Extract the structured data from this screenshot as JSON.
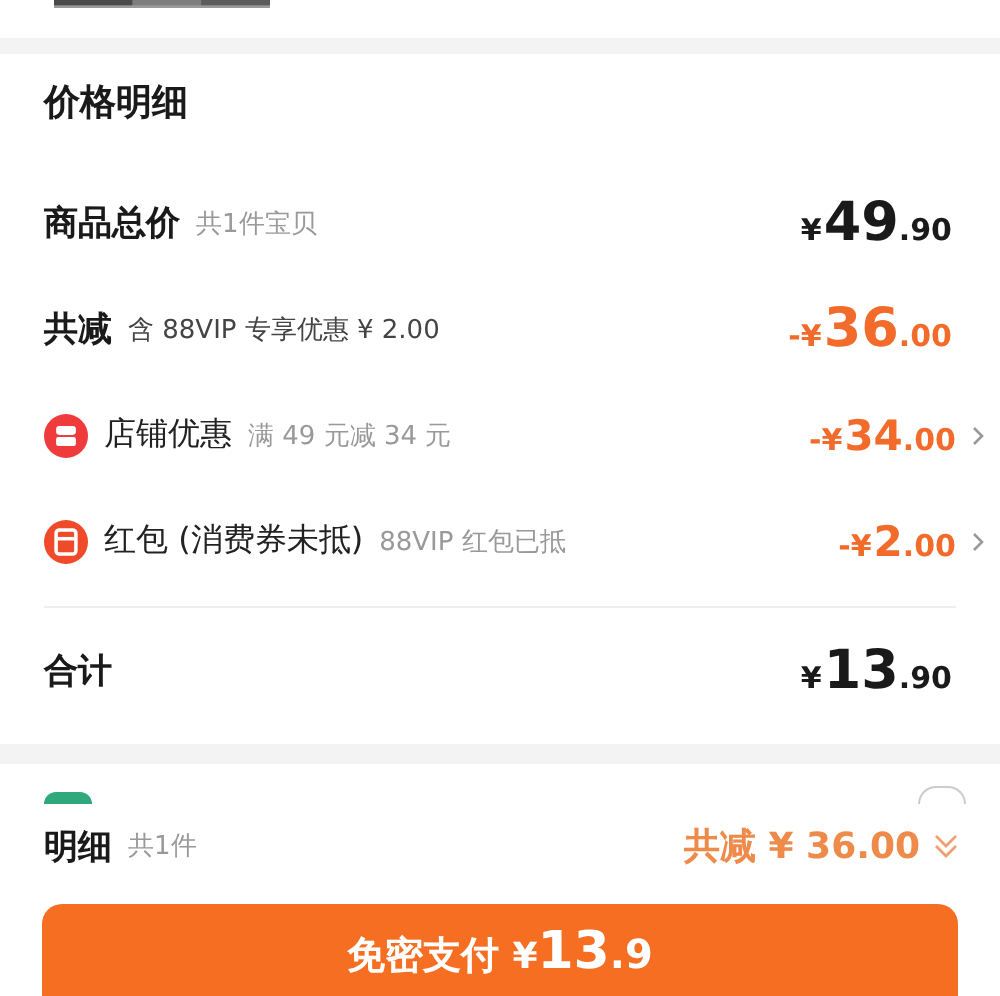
{
  "section_title": "价格明细",
  "total_row": {
    "label": "商品总价",
    "note": "共1件宝贝",
    "price": {
      "currency": "¥",
      "whole": "49",
      "fraction": ".90"
    }
  },
  "discount_row": {
    "label": "共减",
    "note": "含 88VIP 专享优惠 ¥ 2.00",
    "price": {
      "sign": "-",
      "currency": "¥",
      "whole": "36",
      "fraction": ".00"
    }
  },
  "discounts": [
    {
      "kind": "store",
      "label": "店铺优惠",
      "note": "满 49 元减 34 元",
      "price": {
        "sign": "-",
        "currency": "¥",
        "whole": "34",
        "fraction": ".00"
      }
    },
    {
      "kind": "redpacket",
      "label": "红包 (消费券未抵)",
      "note": "88VIP 红包已抵",
      "price": {
        "sign": "-",
        "currency": "¥",
        "whole": "2",
        "fraction": ".00"
      }
    }
  ],
  "sum_row": {
    "label": "合计",
    "price": {
      "currency": "¥",
      "whole": "13",
      "fraction": ".90"
    }
  },
  "payment_option": {
    "selected": false
  },
  "footer": {
    "label": "明细",
    "note": "共1件",
    "saving": "共减 ¥ 36.00",
    "expanded": false
  },
  "pay_button": {
    "label": "免密支付",
    "currency": "¥",
    "whole": "13",
    "fraction": ".9"
  }
}
